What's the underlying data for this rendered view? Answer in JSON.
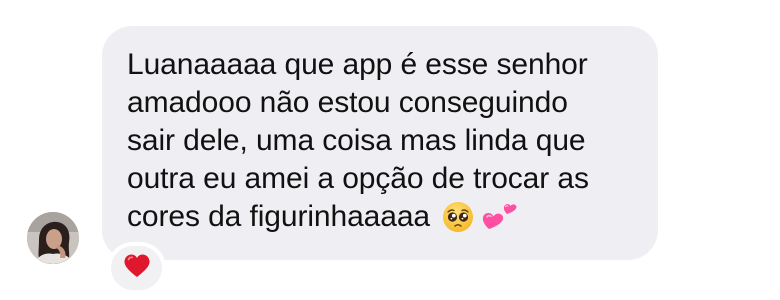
{
  "message": {
    "lines": [
      "Luanaaaaa que app é esse senhor",
      "amadooo não estou conseguindo",
      "sair dele, uma coisa mas linda que",
      "outra eu amei a opção de trocar as",
      "cores da figurinhaaaaa"
    ],
    "emojis": [
      "pleading-face-emoji",
      "two-hearts-emoji"
    ],
    "bubble_color": "#efeff3"
  },
  "sender": {
    "avatar_icon": "profile-photo"
  },
  "reaction": {
    "icon": "red-heart-emoji",
    "color": "#e0182d"
  }
}
